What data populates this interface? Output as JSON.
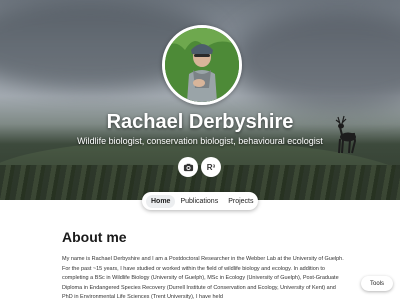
{
  "profile": {
    "name": "Rachael Derbyshire",
    "tagline": "Wildlife biologist, conservation biologist, behavioural ecologist"
  },
  "social": {
    "icons": [
      "camera-icon",
      "researchgate-icon"
    ],
    "researchgate_label": "R³"
  },
  "nav": {
    "items": [
      "Home",
      "Publications",
      "Projects"
    ],
    "active": "Home"
  },
  "about": {
    "heading": "About me",
    "text": "My name is Rachael Derbyshire and I am a Postdoctoral Researcher in the Webber Lab at the University of Guelph. For the past ~15 years, I have studied or worked within the field of wildlife biology and ecology. In addition to completing a BSc in Wildlife Biology (University of Guelph), MSc in Ecology (University of Guelph), Post-Graduate Diploma in Endangered Species Recovery (Durrell Institute of Conservation and Ecology, University of Kent) and PhD in Environmental Life Sciences (Trent University), I have held"
  },
  "tools": {
    "label": "Tools"
  },
  "colors": {
    "hero_text": "#ffffff",
    "nav_active_bg": "#eceef0"
  }
}
